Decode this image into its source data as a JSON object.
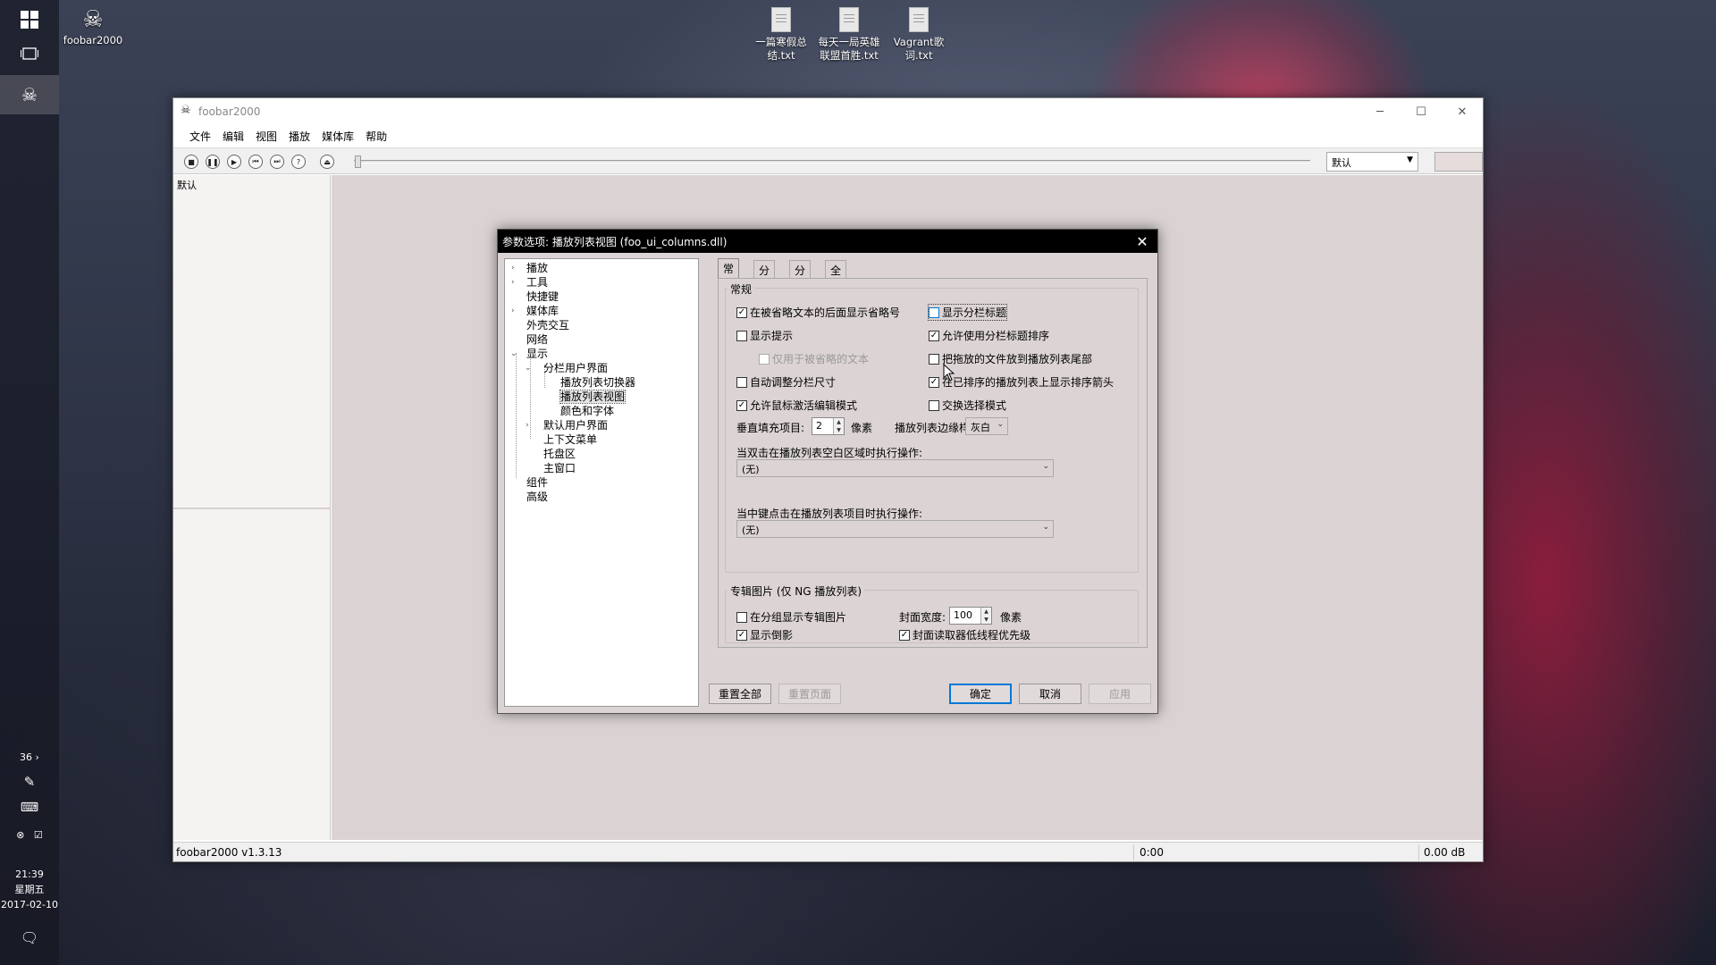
{
  "taskbar": {
    "app_tooltip": "foobar2000",
    "tray_temp": "36",
    "time": "21:39",
    "weekday": "星期五",
    "date": "2017-02-10"
  },
  "desktop": {
    "icons": [
      {
        "label": "foobar2000"
      },
      {
        "label": "一篇寒假总结.txt"
      },
      {
        "label": "每天一局英雄联盟首胜.txt"
      },
      {
        "label": "Vagrant歌词.txt"
      }
    ]
  },
  "main_window": {
    "title": "foobar2000",
    "menu": [
      "文件",
      "编辑",
      "视图",
      "播放",
      "媒体库",
      "帮助"
    ],
    "dsp_preset": "默认",
    "left_panel_label": "默认",
    "status": {
      "version": "foobar2000 v1.3.13",
      "time": "0:00",
      "volume": "0.00 dB"
    }
  },
  "dialog": {
    "title": "参数选项: 播放列表视图 (foo_ui_columns.dll)",
    "tree": [
      {
        "label": "播放"
      },
      {
        "label": "工具"
      },
      {
        "label": "快捷键"
      },
      {
        "label": "媒体库"
      },
      {
        "label": "外壳交互"
      },
      {
        "label": "网络"
      },
      {
        "label": "显示"
      },
      {
        "label": "分栏用户界面"
      },
      {
        "label": "播放列表切换器"
      },
      {
        "label": "播放列表视图"
      },
      {
        "label": "颜色和字体"
      },
      {
        "label": "默认用户界面"
      },
      {
        "label": "上下文菜单"
      },
      {
        "label": "托盘区"
      },
      {
        "label": "主窗口"
      },
      {
        "label": "组件"
      },
      {
        "label": "高级"
      }
    ],
    "tabs": [
      "常规",
      "分组",
      "分栏",
      "全局"
    ],
    "general_group": {
      "label": "常规",
      "options": [
        {
          "label": "在被省略文本的后面显示省略号",
          "checked": true
        },
        {
          "label": "显示分栏标题",
          "checked": false
        },
        {
          "label": "显示提示",
          "checked": false
        },
        {
          "label": "允许使用分栏标题排序",
          "checked": true
        },
        {
          "label": "仅用于被省略的文本",
          "checked": false,
          "disabled": true
        },
        {
          "label": "把拖放的文件放到播放列表尾部",
          "checked": false
        },
        {
          "label": "自动调整分栏尺寸",
          "checked": false
        },
        {
          "label": "在已排序的播放列表上显示排序箭头",
          "checked": true
        },
        {
          "label": "允许鼠标激活编辑模式",
          "checked": true
        },
        {
          "label": "交换选择模式",
          "checked": false
        }
      ],
      "padding_label": "垂直填充项目:",
      "padding_value": "2",
      "padding_unit": "像素",
      "edge_label": "播放列表边缘样",
      "edge_value": "灰白",
      "dblclick_label": "当双击在播放列表空白区域时执行操作:",
      "dblclick_value": "(无)",
      "middleclick_label": "当中键点击在播放列表项目时执行操作:",
      "middleclick_value": "(无)"
    },
    "art_group": {
      "label": "专辑图片 (仅 NG 播放列表)",
      "show_in_group": {
        "label": "在分组显示专辑图片",
        "checked": false
      },
      "show_reflection": {
        "label": "显示倒影",
        "checked": true
      },
      "width_label": "封面宽度:",
      "width_value": "100",
      "width_unit": "像素",
      "low_priority": {
        "label": "封面读取器低线程优先级",
        "checked": true
      }
    },
    "buttons": {
      "reset_all": "重置全部",
      "reset_page": "重置页面",
      "ok": "确定",
      "cancel": "取消",
      "apply": "应用"
    }
  }
}
